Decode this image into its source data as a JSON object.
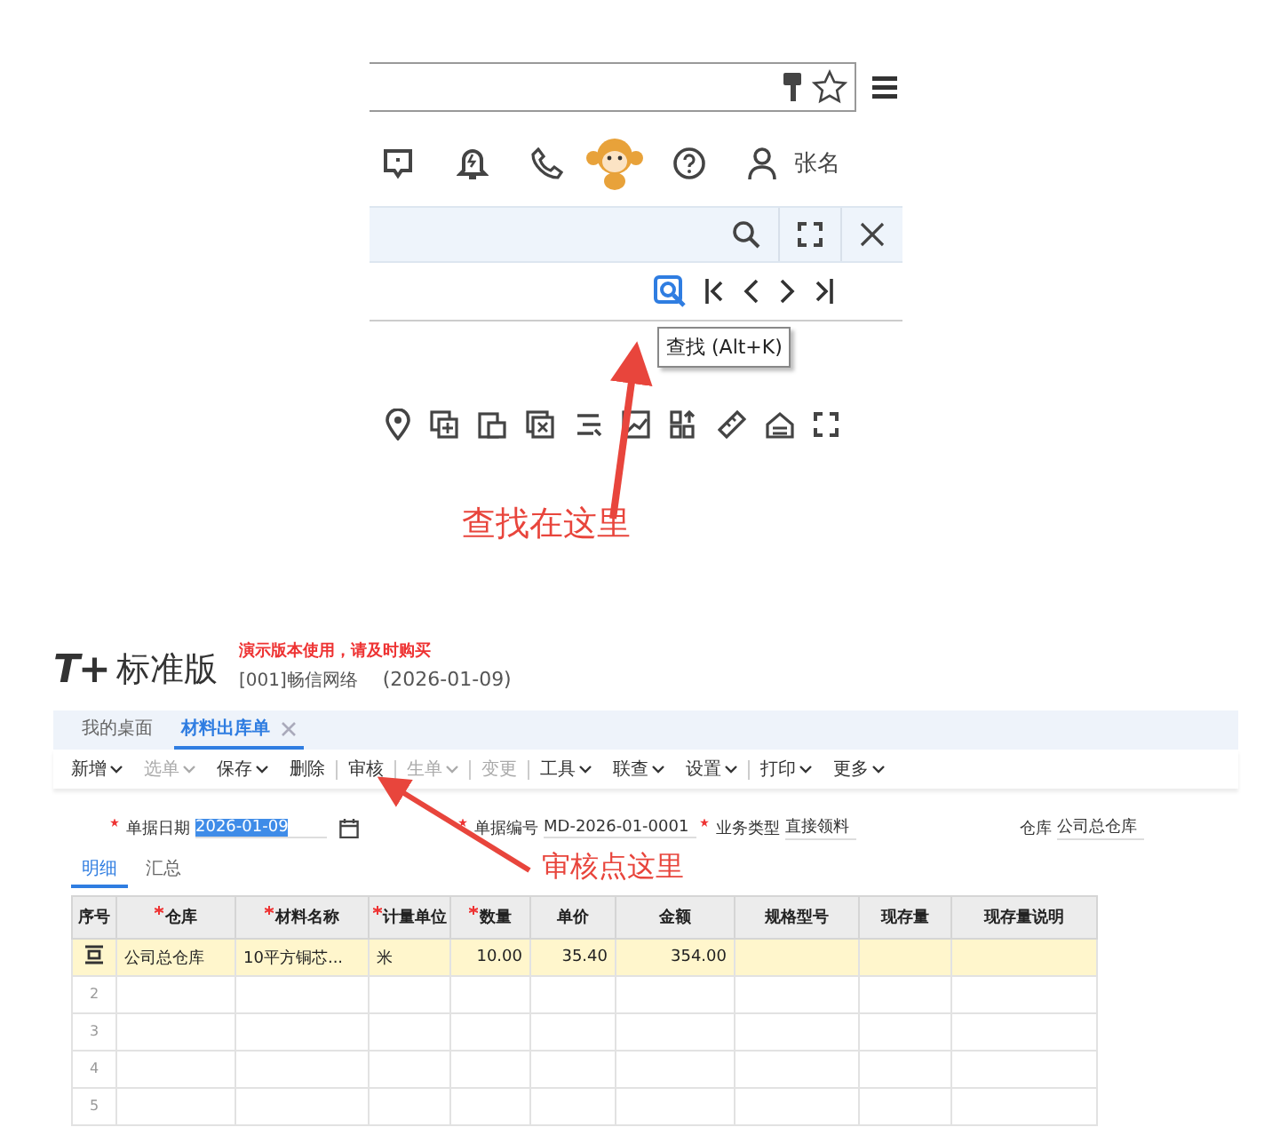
{
  "browser": {
    "user_name": "张名",
    "tooltip": "查找 (Alt+K)"
  },
  "find_callout": "查找在这里",
  "app": {
    "logo": {
      "mark": "T+",
      "name": "标准版"
    },
    "demo_notice": "演示版本使用，请及时购买",
    "company": "[001]畅信网络",
    "date": "(2026-01-09)",
    "tabs": [
      {
        "label": "我的桌面",
        "selected": false,
        "closable": false
      },
      {
        "label": "材料出库单",
        "selected": true,
        "closable": true
      }
    ],
    "toolbar": [
      {
        "label": "新增",
        "dropdown": true,
        "disabled": false,
        "group_end": false
      },
      {
        "label": "选单",
        "dropdown": true,
        "disabled": true,
        "group_end": false
      },
      {
        "label": "保存",
        "dropdown": true,
        "disabled": false,
        "group_end": false
      },
      {
        "label": "删除",
        "dropdown": false,
        "disabled": false,
        "group_end": true
      },
      {
        "label": "审核",
        "dropdown": false,
        "disabled": false,
        "group_end": true
      },
      {
        "label": "生单",
        "dropdown": true,
        "disabled": true,
        "group_end": true
      },
      {
        "label": "变更",
        "dropdown": false,
        "disabled": true,
        "group_end": true
      },
      {
        "label": "工具",
        "dropdown": true,
        "disabled": false,
        "group_end": false
      },
      {
        "label": "联查",
        "dropdown": true,
        "disabled": false,
        "group_end": false
      },
      {
        "label": "设置",
        "dropdown": true,
        "disabled": false,
        "group_end": true
      },
      {
        "label": "打印",
        "dropdown": true,
        "disabled": false,
        "group_end": false
      },
      {
        "label": "更多",
        "dropdown": true,
        "disabled": false,
        "group_end": false
      }
    ],
    "fields": [
      {
        "label": "单据日期",
        "value": "2026-01-09",
        "required": true,
        "kind": "date",
        "highlighted": true
      },
      {
        "label": "单据编号",
        "value": "MD-2026-01-0001",
        "required": true,
        "kind": "text",
        "highlighted": false
      },
      {
        "label": "业务类型",
        "value": "直接领料",
        "required": true,
        "kind": "text",
        "highlighted": false
      },
      {
        "label": "仓库",
        "value": "公司总仓库",
        "required": false,
        "kind": "text",
        "highlighted": false
      }
    ],
    "audit_callout": "审核点这里",
    "subtabs": [
      {
        "label": "明细",
        "selected": true
      },
      {
        "label": "汇总",
        "selected": false
      }
    ],
    "table": {
      "columns": [
        {
          "label": "序号",
          "required": false,
          "kind": "index"
        },
        {
          "label": "仓库",
          "required": true,
          "kind": "text"
        },
        {
          "label": "材料名称",
          "required": true,
          "kind": "text"
        },
        {
          "label": "计量单位",
          "required": true,
          "kind": "text"
        },
        {
          "label": "数量",
          "required": true,
          "kind": "number"
        },
        {
          "label": "单价",
          "required": false,
          "kind": "number"
        },
        {
          "label": "金额",
          "required": false,
          "kind": "number"
        },
        {
          "label": "规格型号",
          "required": false,
          "kind": "text"
        },
        {
          "label": "现存量",
          "required": false,
          "kind": "text"
        },
        {
          "label": "现存量说明",
          "required": false,
          "kind": "text"
        }
      ],
      "rows": [
        {
          "selected": true,
          "cells": [
            "",
            "公司总仓库",
            "10平方铜芯...",
            "米",
            "10.00",
            "35.40",
            "354.00",
            "",
            "",
            ""
          ]
        },
        {
          "selected": false,
          "cells": [
            "2",
            "",
            "",
            "",
            "",
            "",
            "",
            "",
            "",
            ""
          ]
        },
        {
          "selected": false,
          "cells": [
            "3",
            "",
            "",
            "",
            "",
            "",
            "",
            "",
            "",
            ""
          ]
        },
        {
          "selected": false,
          "cells": [
            "4",
            "",
            "",
            "",
            "",
            "",
            "",
            "",
            "",
            ""
          ]
        },
        {
          "selected": false,
          "cells": [
            "5",
            "",
            "",
            "",
            "",
            "",
            "",
            "",
            "",
            ""
          ]
        }
      ]
    }
  }
}
